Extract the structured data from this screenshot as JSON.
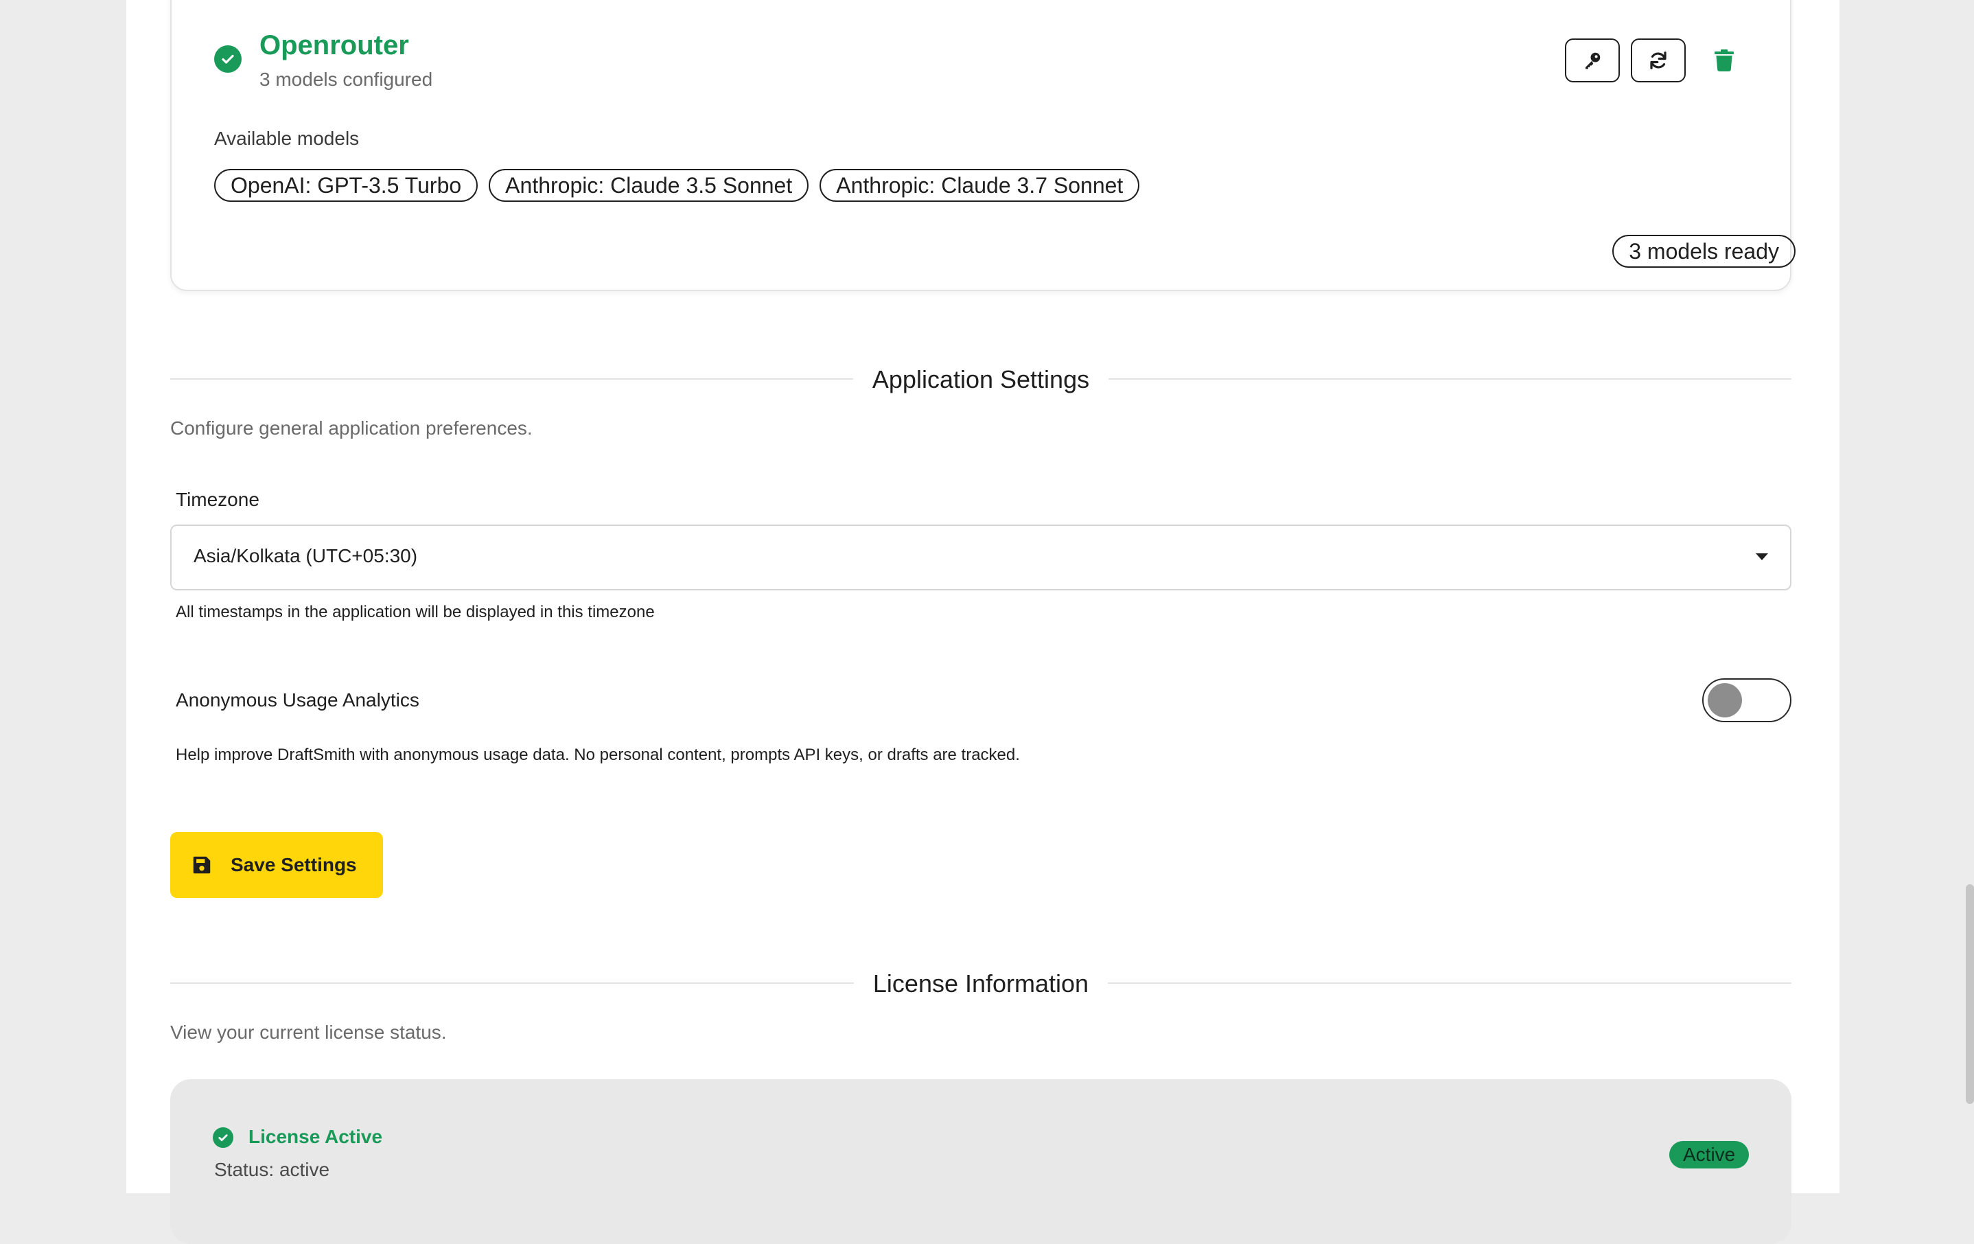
{
  "provider": {
    "name": "Openrouter",
    "subtitle": "3 models configured",
    "models_label": "Available models",
    "models": [
      "OpenAI: GPT-3.5 Turbo",
      "Anthropic: Claude 3.5 Sonnet",
      "Anthropic: Claude 3.7 Sonnet"
    ],
    "ready_badge": "3 models ready"
  },
  "app_settings": {
    "title": "Application Settings",
    "description": "Configure general application preferences.",
    "timezone_label": "Timezone",
    "timezone_value": "Asia/Kolkata (UTC+05:30)",
    "timezone_help": "All timestamps in the application will be displayed in this timezone",
    "analytics_label": "Anonymous Usage Analytics",
    "analytics_enabled": false,
    "analytics_help": "Help improve DraftSmith with anonymous usage data. No personal content, prompts API keys, or drafts are tracked.",
    "save_label": "Save Settings"
  },
  "license": {
    "title": "License Information",
    "description": "View your current license status.",
    "status_title": "License Active",
    "status_text": "Status: active",
    "badge": "Active"
  },
  "colors": {
    "success": "#1a9a59",
    "primary_button": "#ffd60a"
  }
}
